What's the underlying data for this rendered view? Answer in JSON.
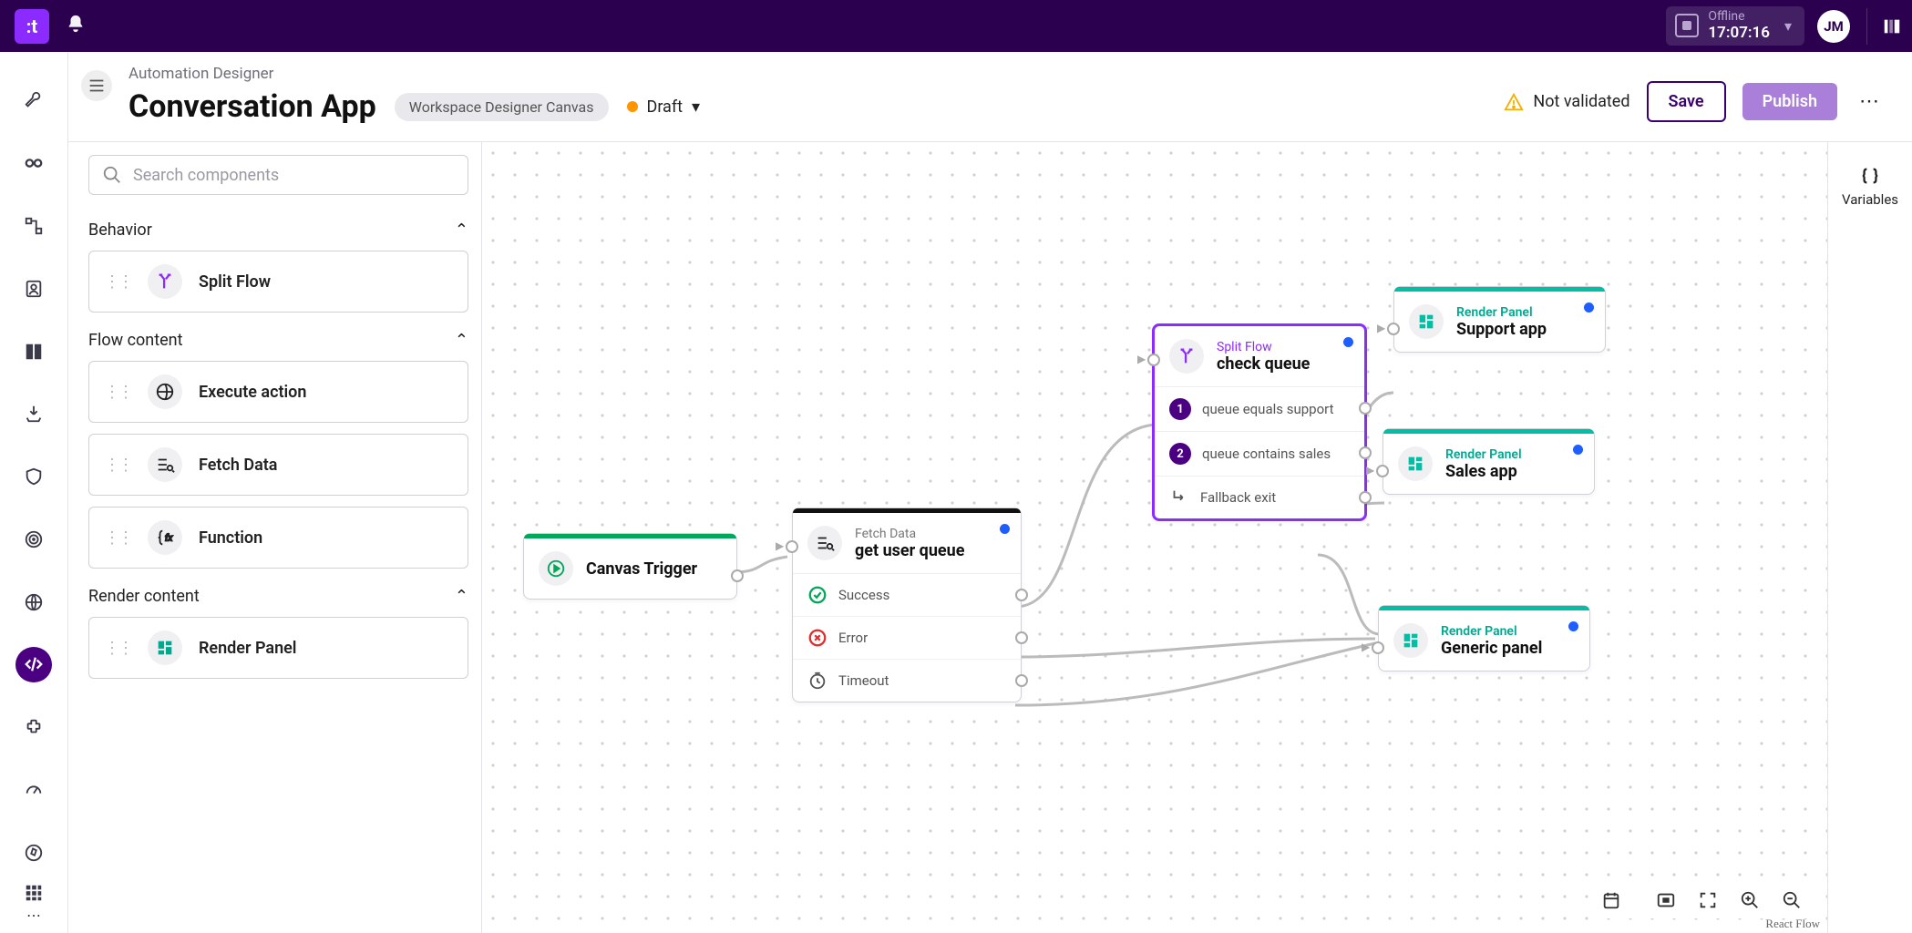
{
  "topbar": {
    "offline_label": "Offline",
    "offline_time": "17:07:16",
    "avatar": "JM"
  },
  "header": {
    "breadcrumb": "Automation Designer",
    "title": "Conversation App",
    "canvas_tag": "Workspace Designer Canvas",
    "status": "Draft",
    "validation_msg": "Not validated",
    "save": "Save",
    "publish": "Publish"
  },
  "search": {
    "placeholder": "Search components"
  },
  "groups": {
    "behavior": {
      "label": "Behavior",
      "items": [
        {
          "name": "Split Flow"
        }
      ]
    },
    "flow_content": {
      "label": "Flow content",
      "items": [
        {
          "name": "Execute action"
        },
        {
          "name": "Fetch Data"
        },
        {
          "name": "Function"
        }
      ]
    },
    "render_content": {
      "label": "Render content",
      "items": [
        {
          "name": "Render Panel"
        }
      ]
    }
  },
  "variables_label": "Variables",
  "nodes": {
    "trigger": {
      "title": "Canvas Trigger"
    },
    "fetch": {
      "type": "Fetch Data",
      "title": "get user queue",
      "rows": {
        "success": "Success",
        "error": "Error",
        "timeout": "Timeout"
      }
    },
    "split": {
      "type": "Split Flow",
      "title": "check queue",
      "rules": [
        "queue equals support",
        "queue contains sales"
      ],
      "fallback": "Fallback exit"
    },
    "support": {
      "type": "Render Panel",
      "title": "Support app"
    },
    "sales": {
      "type": "Render Panel",
      "title": "Sales app"
    },
    "generic": {
      "type": "Render Panel",
      "title": "Generic panel"
    }
  },
  "attribution": "React Flow"
}
